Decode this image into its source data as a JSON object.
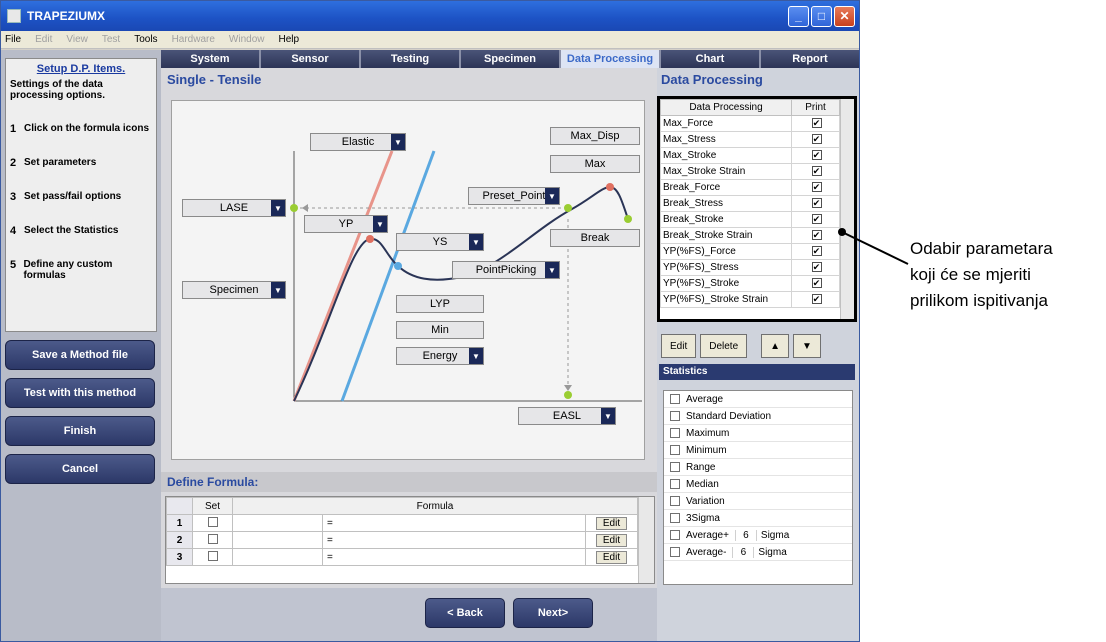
{
  "window": {
    "title": "TRAPEZIUMX"
  },
  "menu": [
    {
      "label": "File",
      "enabled": true
    },
    {
      "label": "Edit",
      "enabled": false
    },
    {
      "label": "View",
      "enabled": false
    },
    {
      "label": "Test",
      "enabled": false
    },
    {
      "label": "Tools",
      "enabled": true
    },
    {
      "label": "Hardware",
      "enabled": false
    },
    {
      "label": "Window",
      "enabled": false
    },
    {
      "label": "Help",
      "enabled": true
    }
  ],
  "steps": {
    "header": "Setup D.P. Items.",
    "description": "Settings of the data processing options.",
    "items": [
      {
        "num": "1",
        "label": "Click on the formula icons"
      },
      {
        "num": "2",
        "label": "Set parameters"
      },
      {
        "num": "3",
        "label": "Set pass/fail options"
      },
      {
        "num": "4",
        "label": "Select the Statistics"
      },
      {
        "num": "5",
        "label": "Define any custom formulas"
      }
    ]
  },
  "left_buttons": [
    "Save a Method file",
    "Test with this method",
    "Finish",
    "Cancel"
  ],
  "tabs": [
    "System",
    "Sensor",
    "Testing",
    "Specimen",
    "Data Processing",
    "Chart",
    "Report"
  ],
  "active_tab": "Data Processing",
  "center": {
    "title": "Single - Tensile",
    "params": {
      "elastic": "Elastic",
      "max_disp": "Max_Disp",
      "max": "Max",
      "preset_point": "Preset_Point",
      "lase": "LASE",
      "yp": "YP",
      "ys": "YS",
      "break": "Break",
      "point_picking": "PointPicking",
      "specimen": "Specimen",
      "lyp": "LYP",
      "min": "Min",
      "energy": "Energy",
      "easl": "EASL"
    },
    "formula_title": "Define Formula:",
    "formula_headers": [
      "Set",
      "Formula"
    ],
    "formula_rows": [
      {
        "num": "1",
        "eq": "=",
        "edit": "Edit"
      },
      {
        "num": "2",
        "eq": "=",
        "edit": "Edit"
      },
      {
        "num": "3",
        "eq": "=",
        "edit": "Edit"
      }
    ],
    "back": "< Back",
    "next": "Next>"
  },
  "right": {
    "title": "Data Processing",
    "table_headers": [
      "Data Processing",
      "Print"
    ],
    "items": [
      "Max_Force",
      "Max_Stress",
      "Max_Stroke",
      "Max_Stroke Strain",
      "Break_Force",
      "Break_Stress",
      "Break_Stroke",
      "Break_Stroke Strain",
      "YP(%FS)_Force",
      "YP(%FS)_Stress",
      "YP(%FS)_Stroke",
      "YP(%FS)_Stroke Strain"
    ],
    "check_mark": "✔",
    "buttons": [
      "Edit",
      "Delete",
      "▲",
      "▼"
    ],
    "stats_title": "Statistics",
    "stats": [
      {
        "label": "Average"
      },
      {
        "label": "Standard Deviation"
      },
      {
        "label": "Maximum"
      },
      {
        "label": "Minimum"
      },
      {
        "label": "Range"
      },
      {
        "label": "Median"
      },
      {
        "label": "Variation"
      },
      {
        "label": "3Sigma"
      },
      {
        "label": "Average+",
        "value": "6",
        "unit": "Sigma"
      },
      {
        "label": "Average-",
        "value": "6",
        "unit": "Sigma"
      }
    ]
  },
  "annotation": {
    "lines": [
      "Odabir parametara",
      "koji će se mjeriti",
      "prilikom ispitivanja"
    ]
  },
  "colors": {
    "title_bar": "#1d52c4",
    "tab_active": "#dde4f4",
    "curve_red": "#e8948a",
    "curve_blue": "#5aa8e0",
    "curve_dark": "#2a3456"
  }
}
